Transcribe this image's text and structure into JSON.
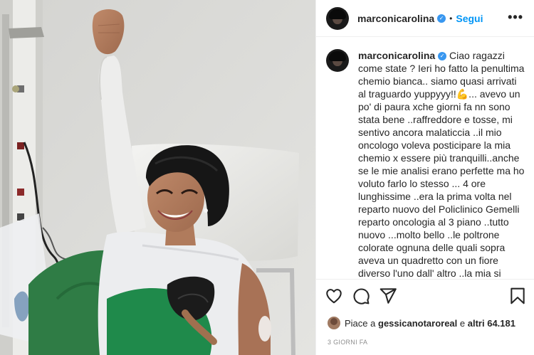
{
  "post": {
    "username": "marconicarolina",
    "follow_label": "Segui",
    "separator": "•",
    "more_label": "•••",
    "verified_mark": "✓"
  },
  "caption": {
    "username": "marconicarolina",
    "text": " Ciao ragazzi come state ? Ieri ho fatto la penultima chemio bianca.. siamo quasi arrivati al traguardo yuppyyy!!💪... avevo un po' di paura xche giorni fa nn sono stata bene ..raffreddore e tosse, mi sentivo ancora malaticcia ..il mio oncologo voleva posticipare la mia chemio x essere più tranquilli..anche se le mie analisi erano perfette ma ho voluto farlo lo stesso ... 4 ore lunghissime ..era la prima volta nel reparto nuovo del Policlinico Gemelli reparto oncologia al 3 piano ..tutto nuovo ...molto bello ..le poltrone colorate ognuna delle quali sopra aveva un quadretto con un fiore diverso l'uno dall' altro ..la mia si chiamava Calla color panna..mi sono portata il mio inseparabile libro di Musso ma nn sono riuscita a concentrarmi ..ero troppo"
  },
  "likes": {
    "prefix": "Piace a",
    "liker": "gessicanotaroreal",
    "conjunction": "e",
    "others": "altri 64.181"
  },
  "time_ago": "3 GIORNI FA",
  "icons": {
    "like": "heart-icon",
    "comment": "comment-icon",
    "share": "share-icon",
    "save": "bookmark-icon"
  },
  "colors": {
    "accent": "#0095f6",
    "verified": "#3897f0",
    "text": "#262626",
    "muted": "#8e8e8e"
  }
}
